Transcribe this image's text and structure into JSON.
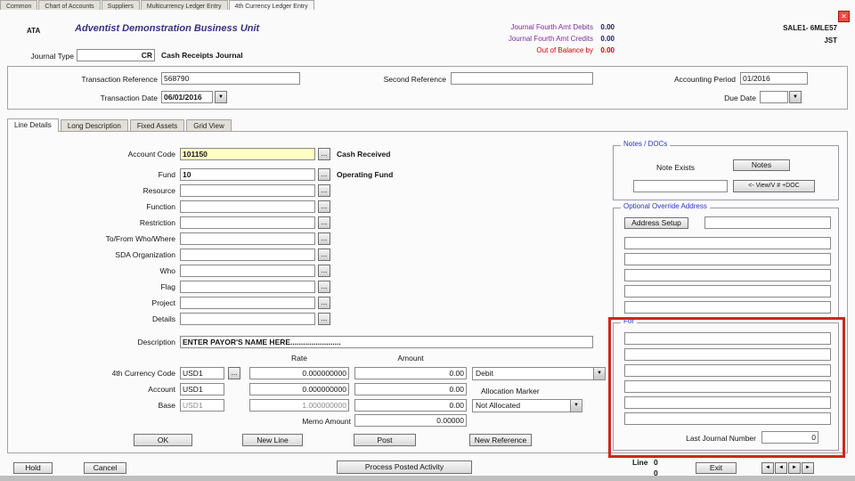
{
  "colors": {
    "field_highlight": "#ffffc6",
    "group_title": "#2b36c9",
    "metric_label": "#7b2f9b",
    "metric_value": "#1c1c5e",
    "out_of_balance": "#d40000",
    "title": "#39307e",
    "highlight_border": "#cc291d"
  },
  "icons": {
    "close": "✕",
    "dropdown": "▼",
    "lookup": "..."
  },
  "top_tabs": [
    "Common",
    "Chart of Accounts",
    "Suppliers",
    "Multicurrency Ledger Entry",
    "4th Currency Ledger Entry"
  ],
  "header": {
    "unit_code": "ATA",
    "business_unit": "Adventist Demonstration Business Unit",
    "debits_label": "Journal Fourth Amt Debits",
    "debits_value": "0.00",
    "credits_label": "Journal Fourth Amt Credits",
    "credits_value": "0.00",
    "oob_label": "Out of Balance by",
    "oob_value": "0.00",
    "station": "SALE1- 6MLE57",
    "user": "JST",
    "journal_type_label": "Journal Type",
    "journal_type_value": "CR",
    "journal_type_name": "Cash Receipts Journal"
  },
  "ref": {
    "transaction_reference_label": "Transaction Reference",
    "transaction_reference_value": "568790",
    "second_reference_label": "Second Reference",
    "second_reference_value": "",
    "accounting_period_label": "Accounting Period",
    "accounting_period_value": "01/2016",
    "transaction_date_label": "Transaction Date",
    "transaction_date_value": "06/01/2016",
    "due_date_label": "Due Date",
    "due_date_value": ""
  },
  "detail_tabs": [
    {
      "label": "Line Details",
      "active": true
    },
    {
      "label": "Long Description",
      "active": false
    },
    {
      "label": "Fixed Assets",
      "active": false
    },
    {
      "label": "Grid View",
      "active": false
    }
  ],
  "form": {
    "rows": [
      {
        "label": "Account Code",
        "value": "101150",
        "desc": "Cash Received",
        "highlight": true
      },
      {
        "label": "Fund",
        "value": "10",
        "desc": "Operating Fund",
        "highlight": false
      },
      {
        "label": "Resource",
        "value": "",
        "desc": "",
        "highlight": false
      },
      {
        "label": "Function",
        "value": "",
        "desc": "",
        "highlight": false
      },
      {
        "label": "Restriction",
        "value": "",
        "desc": "",
        "highlight": false
      },
      {
        "label": "To/From  Who/Where",
        "value": "",
        "desc": "",
        "highlight": false
      },
      {
        "label": "SDA Organization",
        "value": "",
        "desc": "",
        "highlight": false
      },
      {
        "label": "Who",
        "value": "",
        "desc": "",
        "highlight": false
      },
      {
        "label": "Flag",
        "value": "",
        "desc": "",
        "highlight": false
      },
      {
        "label": "Project",
        "value": "",
        "desc": "",
        "highlight": false
      },
      {
        "label": "Details",
        "value": "",
        "desc": "",
        "highlight": false
      }
    ],
    "description_label": "Description",
    "description_value": "ENTER PAYOR'S NAME HERE........................",
    "rate_header": "Rate",
    "amount_header": "Amount",
    "currency_rows": [
      {
        "label": "4th Currency Code",
        "code": "USD1",
        "rate": "0.000000000",
        "amount": "0.00",
        "lookup": true,
        "muted": false
      },
      {
        "label": "Account",
        "code": "USD1",
        "rate": "0.000000000",
        "amount": "0.00",
        "lookup": false,
        "muted": false
      },
      {
        "label": "Base",
        "code": "USD1",
        "rate": "1.000000000",
        "amount": "0.00",
        "lookup": false,
        "muted": true
      }
    ],
    "debit_select": "Debit",
    "allocation_marker_label": "Allocation Marker",
    "alloc_select": "Not Allocated",
    "memo_amount_label": "Memo Amount",
    "memo_amount_value": "0.00000",
    "buttons": [
      "OK",
      "New Line",
      "Post",
      "New Reference"
    ]
  },
  "notes_panel": {
    "title": "Notes / DOCs",
    "note_exists_label": "Note Exists",
    "notes_button": "Notes",
    "note_field_value": "",
    "view_doc_button": "<- View/V # +DOC"
  },
  "address_panel": {
    "title": "Optional Override Address",
    "setup_button": "Address Setup",
    "top_field_value": "",
    "fields": [
      "",
      "",
      "",
      "",
      ""
    ]
  },
  "for_panel": {
    "title": "For",
    "fields": [
      "",
      "",
      "",
      "",
      "",
      ""
    ],
    "last_journal_label": "Last Journal Number",
    "last_journal_value": "0"
  },
  "footer": {
    "hold": "Hold",
    "cancel": "Cancel",
    "process": "Process Posted Activity",
    "line_label": "Line",
    "line_value": "0",
    "line_value2": "0",
    "exit": "Exit",
    "nav": [
      {
        "name": "first",
        "glyph": "◄"
      },
      {
        "name": "prev",
        "glyph": "◄"
      },
      {
        "name": "next",
        "glyph": "►"
      },
      {
        "name": "last",
        "glyph": "►"
      }
    ]
  }
}
